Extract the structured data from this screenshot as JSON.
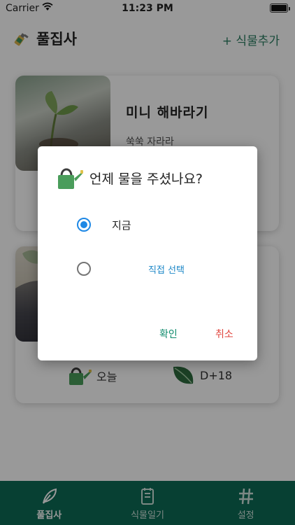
{
  "status_bar": {
    "carrier": "Carrier",
    "time": "11:23 PM"
  },
  "header": {
    "title": "풀집사",
    "add_button": "+ 식물추가"
  },
  "plants": [
    {
      "name": "미니 해바라기",
      "subtitle": "쑥쑥 자라라"
    },
    {
      "water_label": "오늘",
      "days_label": "D+18"
    }
  ],
  "dialog": {
    "title": "언제 물을 주셨나요?",
    "option_now": "지금",
    "option_pick": "직접 선택",
    "selected": "지금",
    "confirm": "확인",
    "cancel": "취소"
  },
  "tabs": [
    {
      "label": "풀집사",
      "active": true
    },
    {
      "label": "식물일기",
      "active": false
    },
    {
      "label": "설정",
      "active": false
    }
  ],
  "colors": {
    "primary": "#0d6b56",
    "radio_selected": "#1e88e5",
    "confirm": "#0d8a6b",
    "cancel": "#e0443c"
  }
}
